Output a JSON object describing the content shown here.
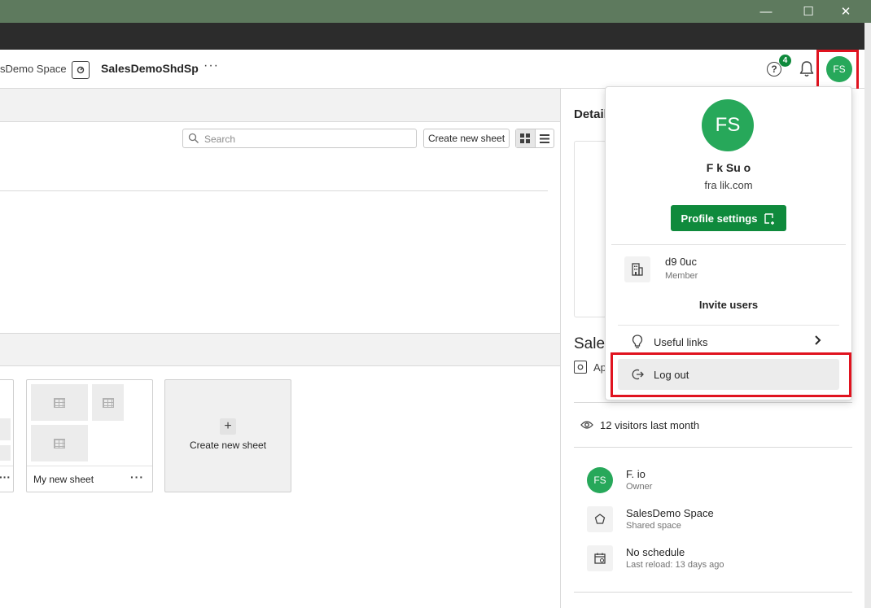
{
  "window": {
    "minimize_glyph": "—",
    "maximize_glyph": "☐",
    "close_glyph": "✕"
  },
  "header": {
    "space_crumb": "sDemo Space",
    "app_name": "SalesDemoShdSp",
    "more_label": "···",
    "help_glyph": "?",
    "notification_count": "4",
    "avatar_initials": "FS"
  },
  "toolbar": {
    "search_placeholder": "Search",
    "create_sheet_label": "Create new sheet"
  },
  "sheets": {
    "cards": [
      {
        "label": "My new sheet",
        "more": "···"
      }
    ],
    "partial_card_more": "···",
    "new_card_plus": "+",
    "new_card_label": "Create new sheet"
  },
  "details": {
    "title": "Detail",
    "app_title": "Sales",
    "app_type_label": "Ap",
    "visitors": "12 visitors last month",
    "owner_initials": "FS",
    "owner_name": "F.          io",
    "owner_role": "Owner",
    "space_name": "SalesDemo Space",
    "space_type": "Shared space",
    "schedule": "No schedule",
    "last_reload": "Last reload: 13 days ago"
  },
  "profile_menu": {
    "avatar_initials": "FS",
    "user_name": "F     k Su    o",
    "user_email": "fra               lik.com",
    "profile_settings_label": "Profile settings",
    "tenant_name": "d9               0uc",
    "tenant_role": "Member",
    "invite_label": "Invite users",
    "useful_links_label": "Useful links",
    "logout_label": "Log out"
  },
  "colors": {
    "titlebar": "#5e7a5e",
    "brand_green": "#0f8a3c",
    "avatar_green": "#27a85a",
    "highlight_red": "#e0131f"
  },
  "icons": [
    "app-icon",
    "help-icon",
    "bell-icon",
    "search-icon",
    "grid-view-icon",
    "list-view-icon",
    "table-icon",
    "eye-icon",
    "space-icon",
    "calendar-icon",
    "building-icon",
    "external-link-icon",
    "bulb-icon",
    "chevron-right-icon",
    "logout-icon"
  ]
}
